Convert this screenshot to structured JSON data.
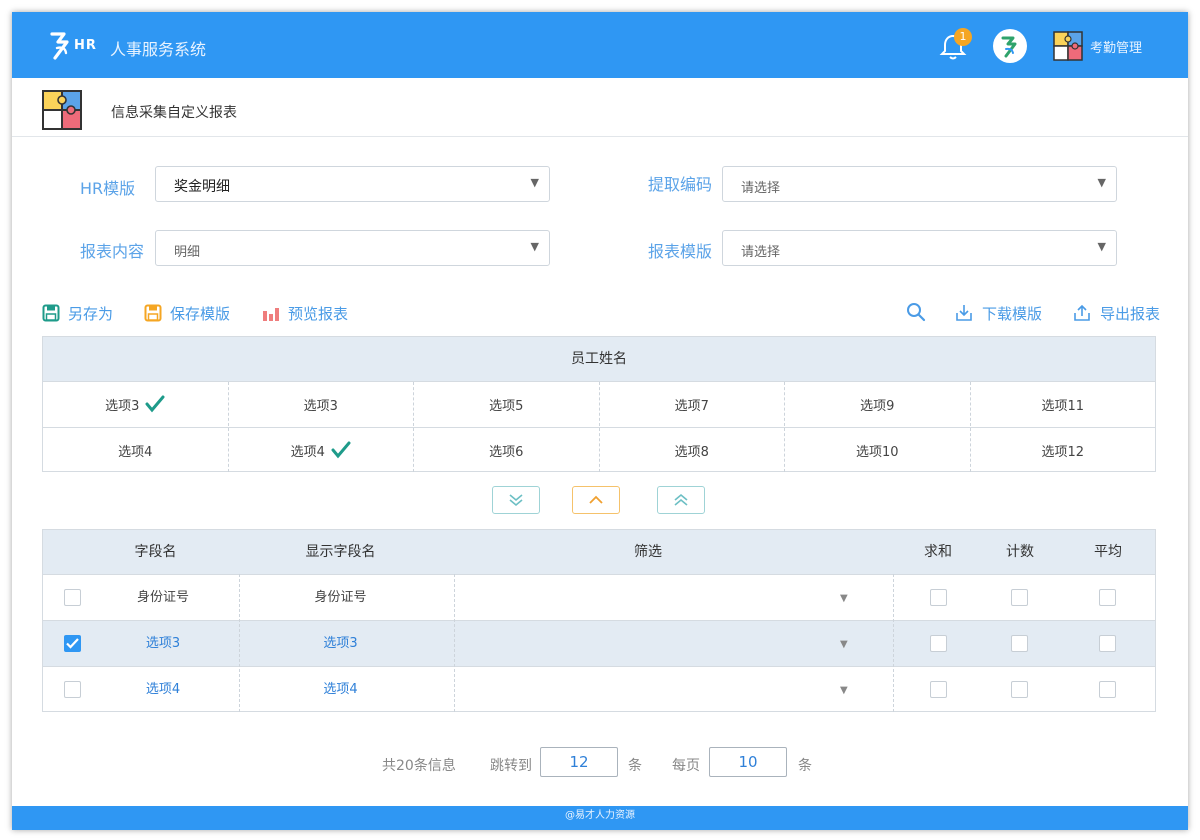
{
  "header": {
    "logo_text": "HR",
    "app_title": "人事服务系统",
    "notification_count": "1",
    "attendance_label": "考勤管理"
  },
  "page": {
    "title": "信息采集自定义报表"
  },
  "form": {
    "hr_template_label": "HR模版",
    "hr_template_value": "奖金明细",
    "extract_code_label": "提取编码",
    "extract_code_placeholder": "请选择",
    "report_content_label": "报表内容",
    "report_content_value": "明细",
    "report_template_label": "报表模版",
    "report_template_placeholder": "请选择"
  },
  "toolbar": {
    "save_as": "另存为",
    "save_template": "保存模版",
    "preview_report": "预览报表",
    "download_template": "下载模版",
    "export_report": "导出报表"
  },
  "options_grid": {
    "header": "员工姓名",
    "rows": [
      [
        {
          "label": "选项3",
          "checked": true
        },
        {
          "label": "选项3"
        },
        {
          "label": "选项5"
        },
        {
          "label": "选项7"
        },
        {
          "label": "选项9"
        },
        {
          "label": "选项11"
        }
      ],
      [
        {
          "label": "选项4"
        },
        {
          "label": "选项4",
          "checked": true
        },
        {
          "label": "选项6"
        },
        {
          "label": "选项8"
        },
        {
          "label": "选项10"
        },
        {
          "label": "选项12"
        }
      ]
    ]
  },
  "fields_table": {
    "columns": {
      "field_name": "字段名",
      "display_name": "显示字段名",
      "filter": "筛选",
      "sum": "求和",
      "count": "计数",
      "average": "平均"
    },
    "rows": [
      {
        "field": "身份证号",
        "display": "身份证号",
        "checked": false,
        "highlight": false
      },
      {
        "field": "选项3",
        "display": "选项3",
        "checked": true,
        "highlight": true
      },
      {
        "field": "选项4",
        "display": "选项4",
        "checked": false,
        "highlight": true
      }
    ]
  },
  "pagination": {
    "total": "共20条信息",
    "jump_label": "跳转到",
    "jump_value": "12",
    "unit1": "条",
    "per_page_label": "每页",
    "per_page_value": "10",
    "unit2": "条"
  },
  "footer": {
    "text": "@易才人力资源"
  },
  "colors": {
    "primary": "#2f97f3",
    "accent_orange": "#f5a623",
    "check_teal": "#1e9b8a",
    "link_blue": "#2f80d8"
  }
}
